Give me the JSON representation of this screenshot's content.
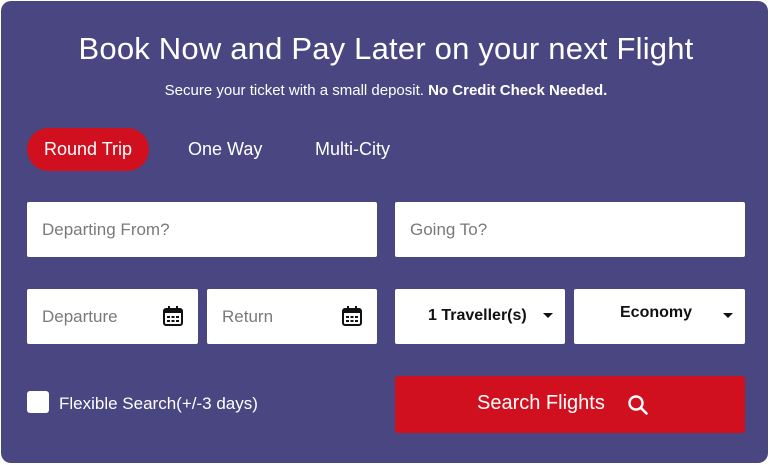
{
  "header": {
    "title": "Book Now and Pay Later on your next Flight",
    "subtitle_plain": "Secure your ticket with a small deposit.",
    "subtitle_bold": "No Credit Check Needed."
  },
  "trip_types": {
    "round_trip": "Round Trip",
    "one_way": "One Way",
    "multi_city": "Multi-City",
    "selected": "Round Trip"
  },
  "form": {
    "from_placeholder": "Departing From?",
    "to_placeholder": "Going To?",
    "departure_placeholder": "Departure",
    "return_placeholder": "Return",
    "travellers_value": "1 Traveller(s)",
    "class_value": "Economy",
    "flexible_label": "Flexible Search(+/-3 days)",
    "flexible_checked": false,
    "search_label": "Search Flights"
  },
  "colors": {
    "panel_bg": "#4a4681",
    "accent_red": "#d0101e",
    "field_bg": "#ffffff"
  },
  "icons": {
    "date_picker": "calendar-icon",
    "dropdown": "caret-down-icon",
    "search": "search-icon"
  }
}
